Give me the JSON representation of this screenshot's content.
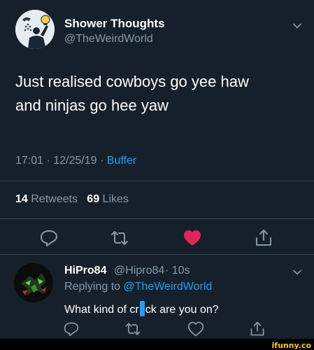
{
  "tweet": {
    "display_name": "Shower Thoughts",
    "handle": "@TheWeirdWorld",
    "text_line1": "Just realised cowboys go yee haw",
    "text_line2": "and ninjas go hee yaw",
    "time": "17:01 · 12/25/19 · ",
    "source": "Buffer",
    "retweets_count": "14",
    "retweets_label": "Retweets",
    "likes_count": "69",
    "likes_label": "Likes",
    "liked": true,
    "icons": [
      "chevron-down-icon",
      "reply-icon",
      "retweet-icon",
      "heart-icon",
      "share-icon"
    ]
  },
  "reply": {
    "display_name": "HiPro84",
    "handle": "@Hipro84",
    "time": "· 10s",
    "replying_prefix": "Replying to ",
    "replying_to": "@TheWeirdWorld",
    "text_before": "What kind of cr",
    "text_after": "ck are you on?",
    "icons": [
      "chevron-down-icon",
      "reply-icon",
      "retweet-icon",
      "heart-outline-icon",
      "share-icon"
    ]
  },
  "watermark": "ifunny.co",
  "colors": {
    "background": "#15202b",
    "secondary_text": "#8899a6",
    "link": "#1da1f2",
    "like": "#e0245e",
    "divider": "#38444d"
  }
}
